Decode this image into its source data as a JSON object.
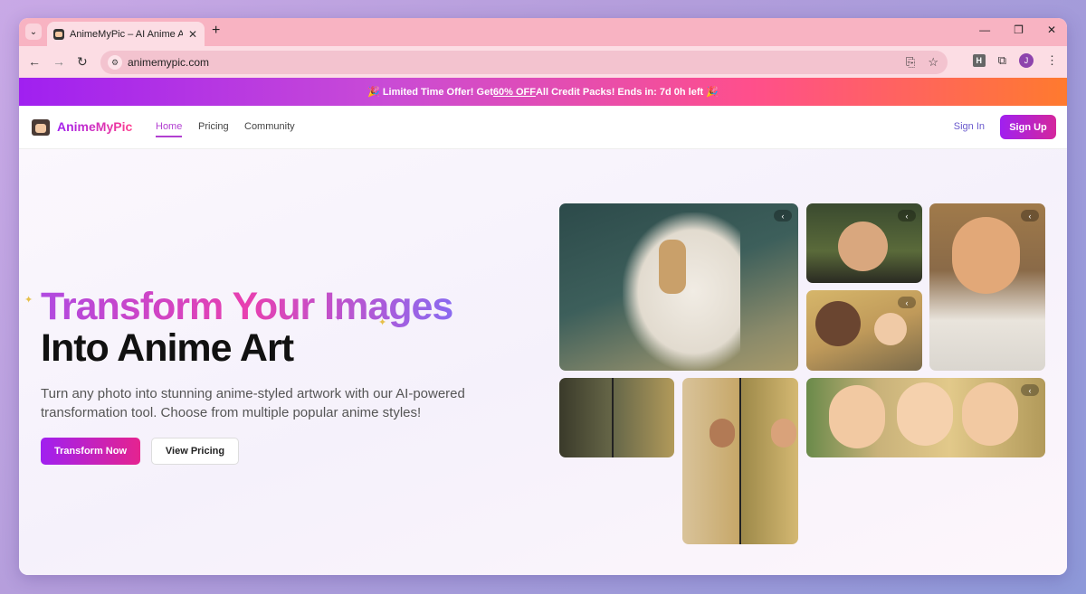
{
  "browser": {
    "tab_title": "AnimeMyPic – AI Anime Art Ge",
    "tab_close": "✕",
    "new_tab": "+",
    "url": "animemypic.com",
    "profile_initial": "J",
    "extension_label": "H"
  },
  "promo": {
    "prefix": "🎉 Limited Time Offer! Get ",
    "highlight": "60% OFF",
    "suffix": " All Credit Packs! Ends in: 7d 0h left 🎉"
  },
  "nav": {
    "logo": "AnimeMyPic",
    "links": [
      "Home",
      "Pricing",
      "Community"
    ],
    "sign_in": "Sign In",
    "sign_up": "Sign Up"
  },
  "hero": {
    "title_line1": "Transform Your Images",
    "title_line2": "Into Anime Art",
    "description": "Turn any photo into stunning anime-styled artwork with our AI-powered transformation tool. Choose from multiple popular anime styles!",
    "primary_button": "Transform Now",
    "secondary_button": "View Pricing"
  },
  "gallery": {
    "chevron": "‹"
  },
  "colors": {
    "accent_purple": "#a020f0",
    "accent_pink": "#e5238f",
    "promo_orange": "#ff7a2e"
  }
}
